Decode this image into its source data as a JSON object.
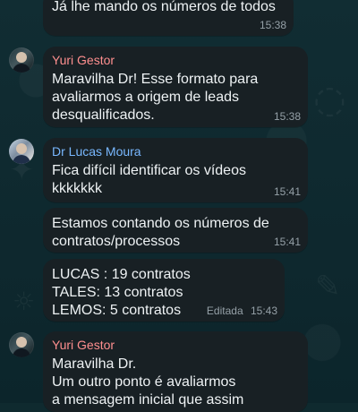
{
  "messages": [
    {
      "text": "Já lhe mando os números de todos",
      "time": "15:38"
    },
    {
      "sender": "Yuri Gestor",
      "text": "Maravilha Dr! Esse formato para\navaliarmos a origem de leads\ndesqualificados.",
      "time": "15:38"
    },
    {
      "sender": "Dr Lucas Moura",
      "text": "Fica difícil identificar os vídeos\nkkkkkkk",
      "time": "15:41"
    },
    {
      "text": "Estamos contando os números de\ncontratos/processos",
      "time": "15:41"
    },
    {
      "text": "LUCAS : 19 contratos\nTALES: 13 contratos\nLEMOS: 5 contratos",
      "edited": "Editada",
      "time": "15:43"
    },
    {
      "sender": "Yuri Gestor",
      "text": "Maravilha Dr.\nUm outro ponto é avaliarmos\na mensagem inicial que assim"
    }
  ],
  "colors": {
    "background": "#0f2a2f",
    "bubble": "#182024",
    "text": "#eef2f4",
    "meta": "#95a0a7",
    "sender_red": "#ff8f8f",
    "sender_blue": "#79b8ff"
  },
  "icons": {
    "avatar_yuri": "user-avatar",
    "avatar_lucas": "user-avatar"
  }
}
